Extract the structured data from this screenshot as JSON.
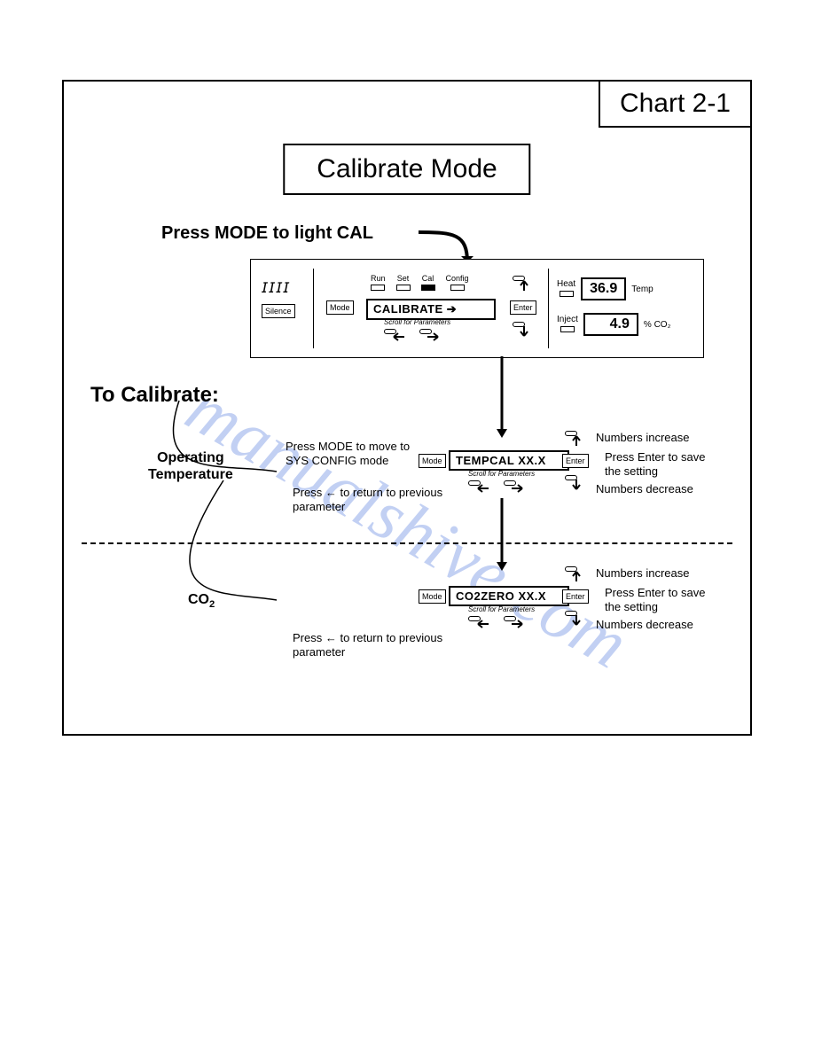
{
  "chart_label": "Chart 2-1",
  "title": "Calibrate Mode",
  "instruction_top": "Press MODE to light CAL",
  "to_calibrate": "To Calibrate:",
  "section1_label": "Operating\nTemperature",
  "section2_label_a": "CO",
  "section2_label_b": "2",
  "panel": {
    "silence": "Silence",
    "mode": "Mode",
    "leds": {
      "run": "Run",
      "set": "Set",
      "cal": "Cal",
      "config": "Config"
    },
    "main_disp": "CALIBRATE  ➔",
    "scroll_hint": "Scroll for Parameters",
    "enter": "Enter",
    "heat": "Heat",
    "temp_val": "36.9",
    "temp_lbl": "Temp",
    "inject": "Inject",
    "co2_val": "4.9",
    "co2_lbl": "% CO₂"
  },
  "step1": {
    "mode_note": "Press MODE to move to SYS CONFIG mode",
    "return_note": "Press ← to return to previous parameter",
    "disp": "TEMPCAL  XX.X",
    "scroll_hint": "Scroll for Parameters",
    "up_note": "Numbers increase",
    "enter_note": "Press Enter to save the setting",
    "down_note": "Numbers decrease",
    "mode": "Mode",
    "enter": "Enter"
  },
  "step2": {
    "return_note": "Press ← to return to previous parameter",
    "disp": "CO2ZERO   XX.X",
    "scroll_hint": "Scroll for Parameters",
    "up_note": "Numbers increase",
    "enter_note": "Press Enter to save the setting",
    "down_note": "Numbers decrease",
    "mode": "Mode",
    "enter": "Enter"
  },
  "watermark": "manualshive.com"
}
